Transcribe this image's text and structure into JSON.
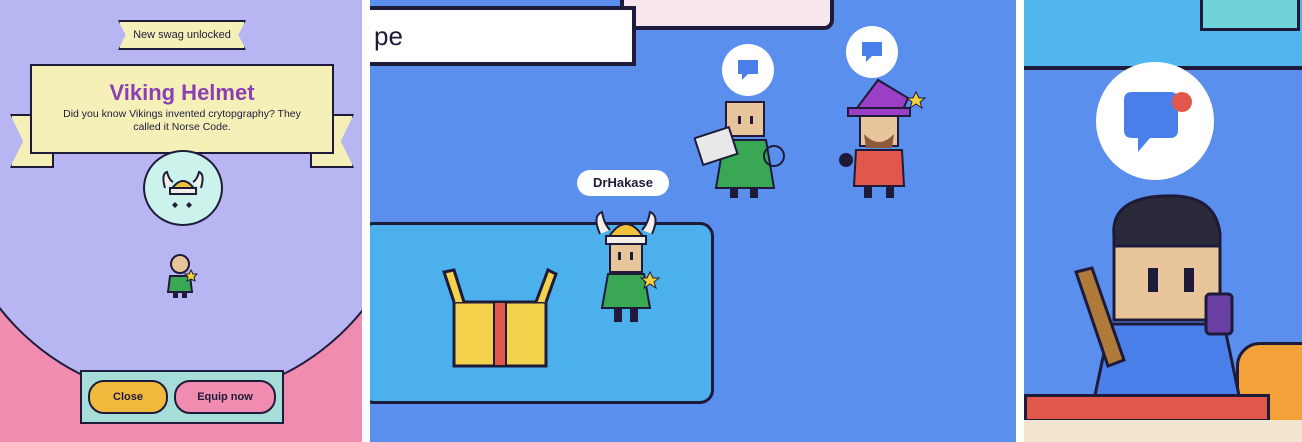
{
  "modal": {
    "ribbon_label": "New swag unlocked",
    "item_title": "Viking Helmet",
    "item_description": "Did you know Vikings invented crytopgraphy? They called it Norse Code.",
    "close_label": "Close",
    "equip_label": "Equip now"
  },
  "scene": {
    "text_field_value": "pe",
    "player_name": "DrHakase"
  },
  "colors": {
    "modal_circle": "#b8b6f2",
    "panel_pink": "#f08cb0",
    "scene_blue": "#5b8fee",
    "title_purple": "#8c3fb4",
    "notification_red": "#e2574c"
  }
}
